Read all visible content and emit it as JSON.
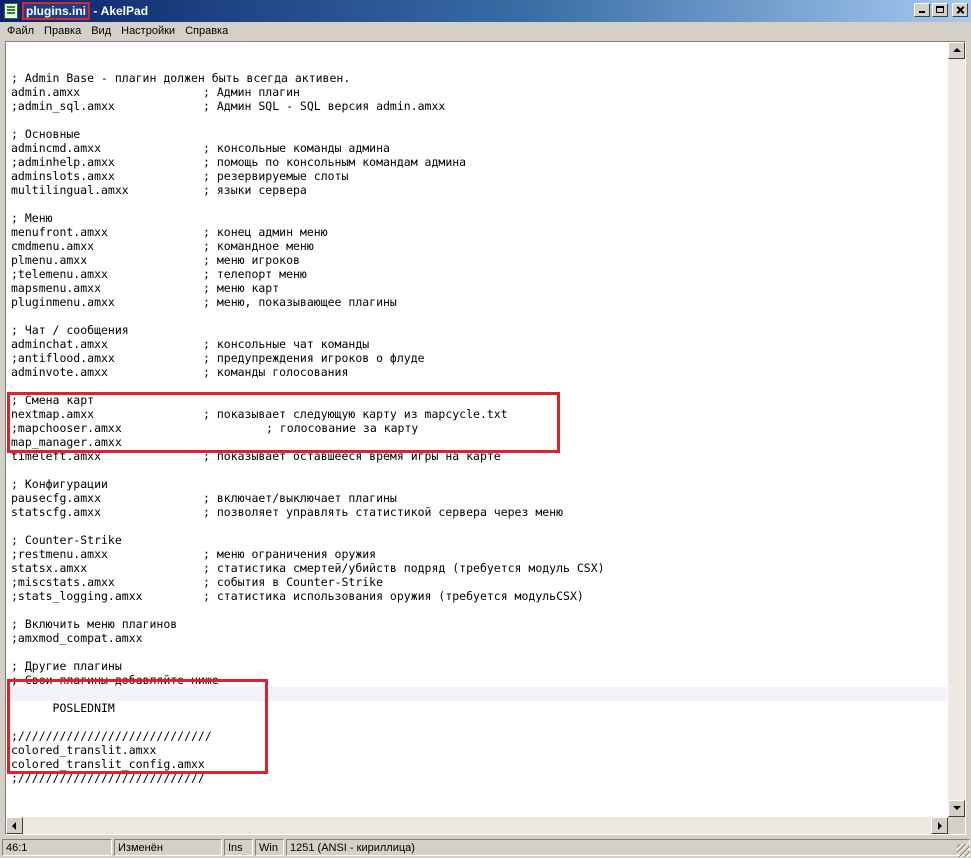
{
  "window": {
    "file_name": "plugins.ini",
    "app_name": "AkelPad",
    "separator": " - "
  },
  "menu": [
    "Файл",
    "Правка",
    "Вид",
    "Настройки",
    "Справка"
  ],
  "editor": {
    "lines": [
      {
        "code": "",
        "comment": ""
      },
      {
        "code": "; Admin Base - плагин должен быть всегда активен.",
        "comment": ""
      },
      {
        "code": "admin.amxx",
        "comment": "; Админ плагин"
      },
      {
        "code": ";admin_sql.amxx",
        "comment": "; Админ SQL - SQL версия admin.amxx"
      },
      {
        "code": "",
        "comment": ""
      },
      {
        "code": "; Основные",
        "comment": ""
      },
      {
        "code": "admincmd.amxx",
        "comment": "; консольные команды админа"
      },
      {
        "code": ";adminhelp.amxx",
        "comment": "; помощь по консольным командам админа"
      },
      {
        "code": "adminslots.amxx",
        "comment": "; резервируемые слоты"
      },
      {
        "code": "multilingual.amxx",
        "comment": "; языки сервера"
      },
      {
        "code": "",
        "comment": ""
      },
      {
        "code": "; Меню",
        "comment": ""
      },
      {
        "code": "menufront.amxx",
        "comment": "; конец админ меню"
      },
      {
        "code": "cmdmenu.amxx",
        "comment": "; командное меню"
      },
      {
        "code": "plmenu.amxx",
        "comment": "; меню игроков"
      },
      {
        "code": ";telemenu.amxx",
        "comment": "; телепорт меню"
      },
      {
        "code": "mapsmenu.amxx",
        "comment": "; меню карт"
      },
      {
        "code": "pluginmenu.amxx",
        "comment": "; меню, показывающее плагины"
      },
      {
        "code": "",
        "comment": ""
      },
      {
        "code": "; Чат / сообщения",
        "comment": ""
      },
      {
        "code": "adminchat.amxx",
        "comment": "; консольные чат команды"
      },
      {
        "code": ";antiflood.amxx",
        "comment": "; предупреждения игроков о флуде"
      },
      {
        "code": "adminvote.amxx",
        "comment": "; команды голосования"
      },
      {
        "code": "",
        "comment": ""
      },
      {
        "code": "; Смена карт",
        "comment": ""
      },
      {
        "code": "nextmap.amxx",
        "comment": "; показывает следующую карту из mapcycle.txt"
      },
      {
        "code": ";mapchooser.amxx",
        "comment": "; голосование за карту",
        "far": true
      },
      {
        "code": "map_manager.amxx",
        "comment": ""
      },
      {
        "code": "timeleft.amxx",
        "comment": "; показывает оставшееся время игры на карте"
      },
      {
        "code": "",
        "comment": ""
      },
      {
        "code": "; Конфигурации",
        "comment": ""
      },
      {
        "code": "pausecfg.amxx",
        "comment": "; включает/выключает плагины"
      },
      {
        "code": "statscfg.amxx",
        "comment": "; позволяет управлять статистикой сервера через меню"
      },
      {
        "code": "",
        "comment": ""
      },
      {
        "code": "; Counter-Strike",
        "comment": ""
      },
      {
        "code": ";restmenu.amxx",
        "comment": "; меню ограничения оружия"
      },
      {
        "code": "statsx.amxx",
        "comment": "; статистика смертей/убийств подряд (требуется модуль CSX)"
      },
      {
        "code": ";miscstats.amxx",
        "comment": "; события в Counter-Strike"
      },
      {
        "code": ";stats_logging.amxx",
        "comment": "; статистика использования оружия (требуется модульCSX)"
      },
      {
        "code": "",
        "comment": ""
      },
      {
        "code": "; Включить меню плагинов",
        "comment": ""
      },
      {
        "code": ";amxmod_compat.amxx",
        "comment": ""
      },
      {
        "code": "",
        "comment": ""
      },
      {
        "code": "; Другие плагины",
        "comment": ""
      },
      {
        "code": "; Свои плагины добавляйте ниже",
        "comment": ""
      },
      {
        "code": "",
        "comment": "",
        "current": true
      },
      {
        "code": "      POSLEDNIM",
        "comment": ""
      },
      {
        "code": "",
        "comment": ""
      },
      {
        "code": ";////////////////////////////",
        "comment": ""
      },
      {
        "code": "colored_translit.amxx",
        "comment": ""
      },
      {
        "code": "colored_translit_config.amxx",
        "comment": ""
      },
      {
        "code": ";///////////////////////////",
        "comment": ""
      }
    ]
  },
  "status": {
    "position": "46:1",
    "modified": "Изменён",
    "insert_mode": "Ins",
    "newline": "Win",
    "encoding": "1251  (ANSI - кириллица)"
  },
  "colors": {
    "highlight_box": "#e0202a",
    "title_gradient_start": "#0a246a",
    "title_gradient_end": "#a6caf0"
  }
}
